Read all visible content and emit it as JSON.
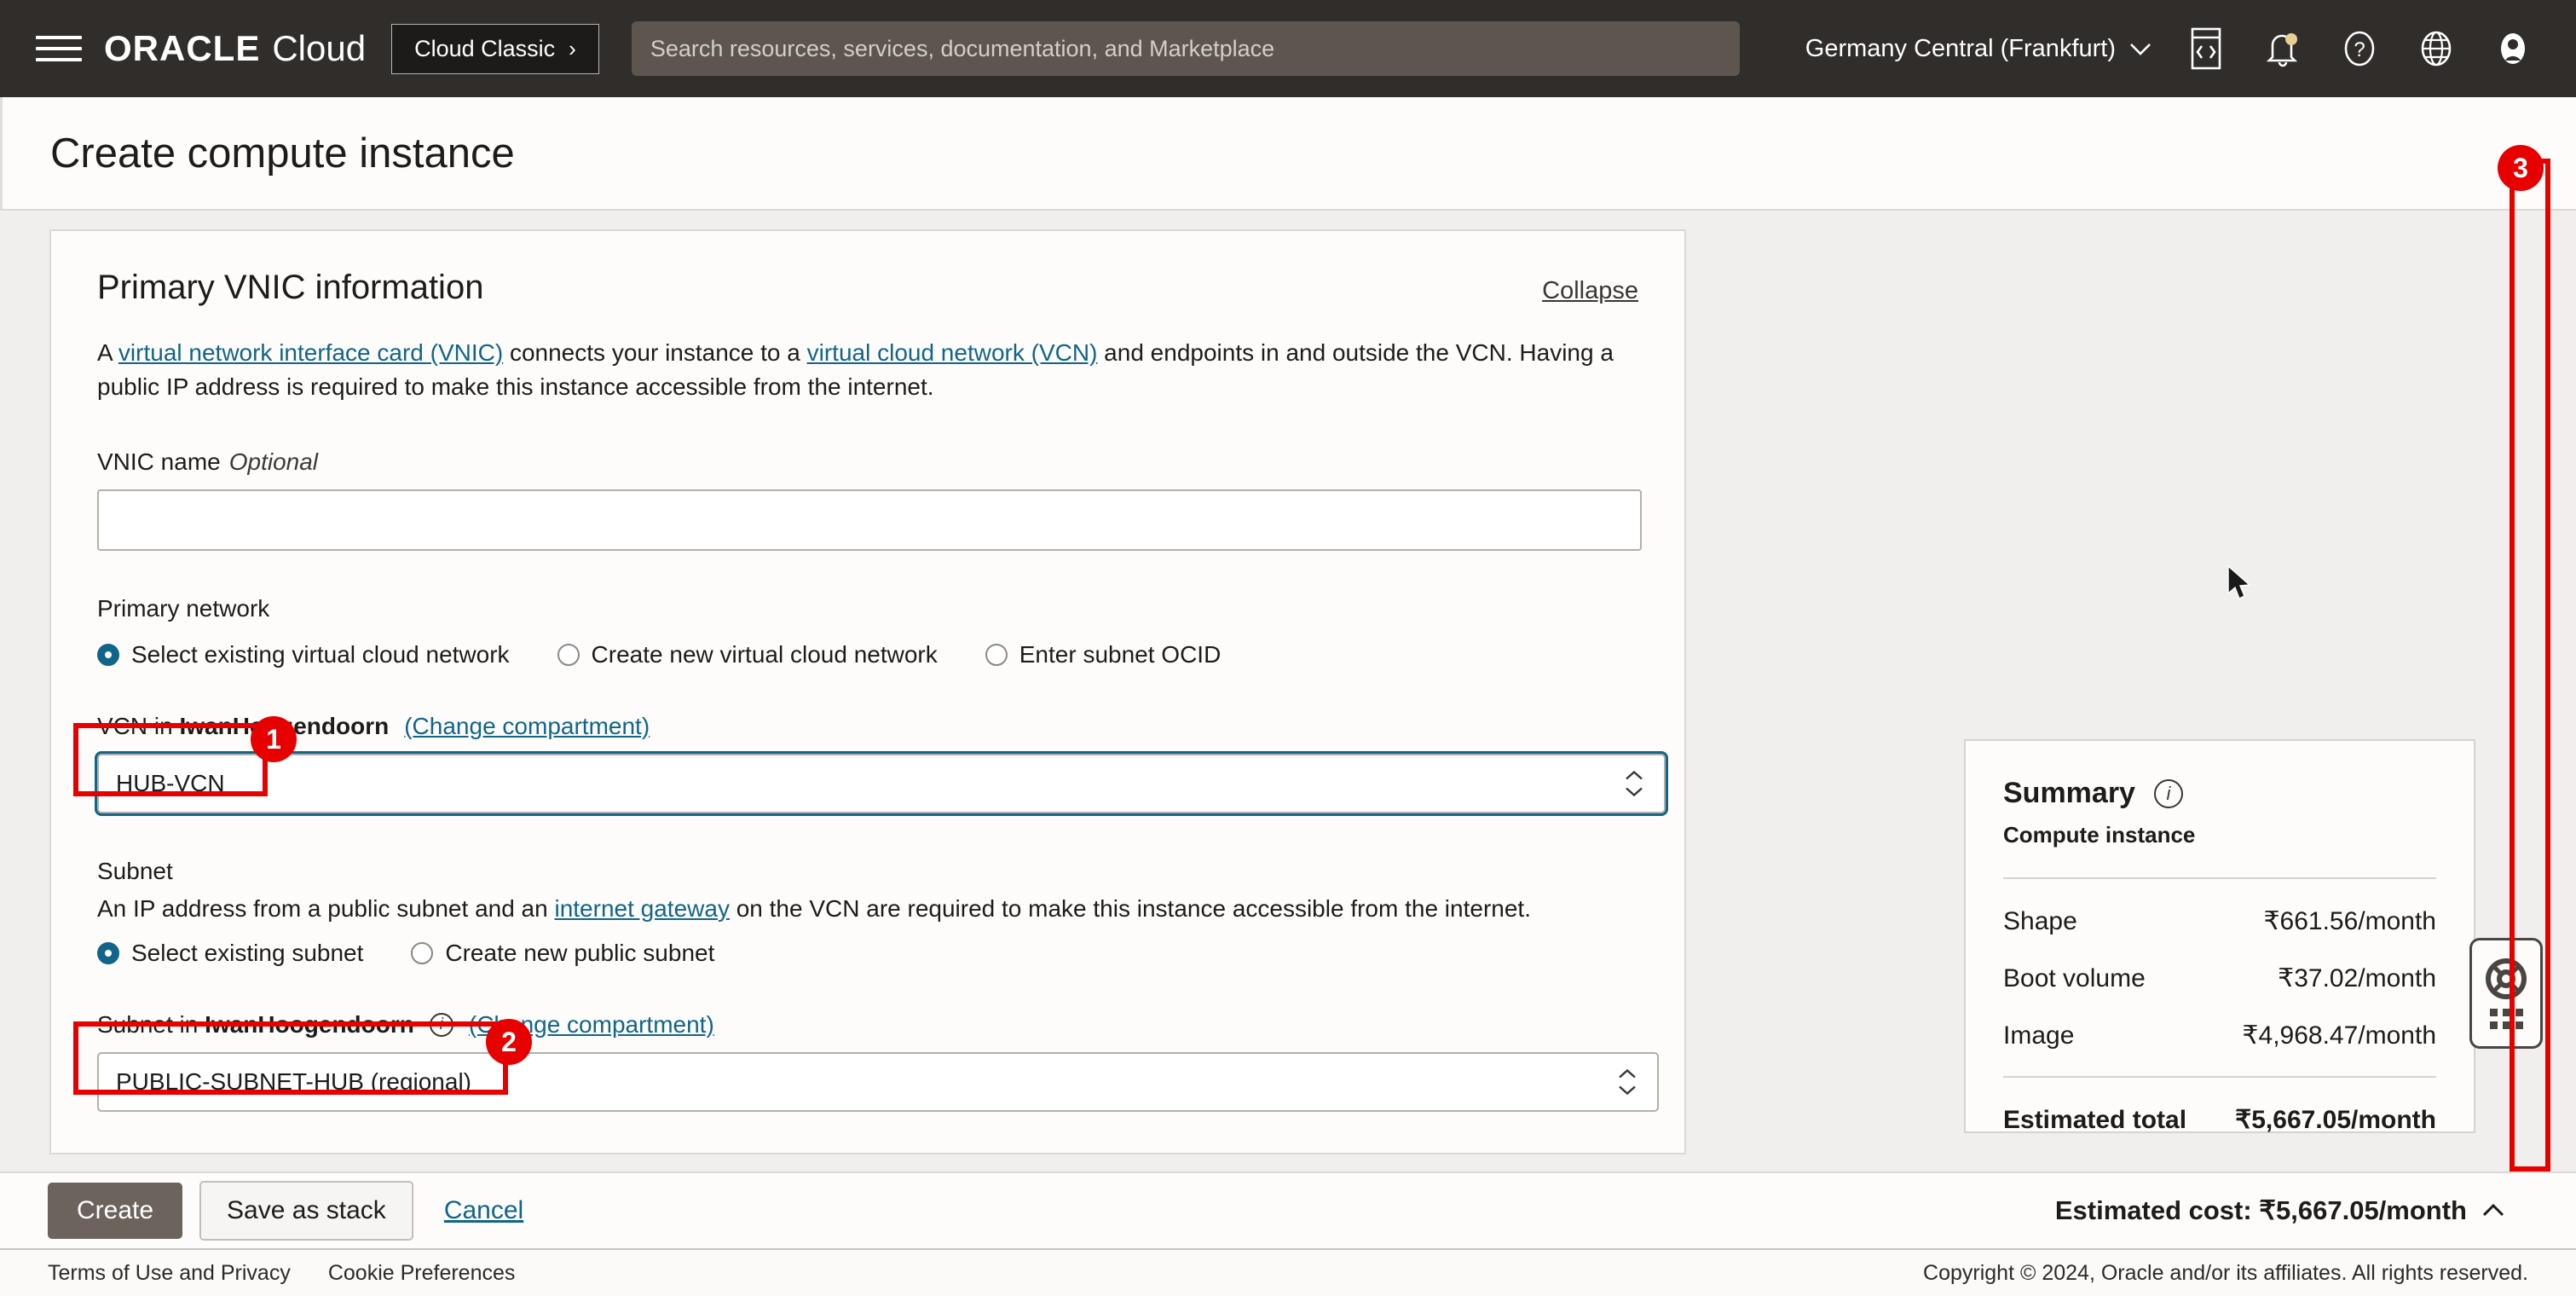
{
  "topbar": {
    "menu_icon": "hamburger-icon",
    "brand_oracle": "ORACLE",
    "brand_cloud": "Cloud",
    "cloud_classic_label": "Cloud Classic",
    "cloud_classic_chevron": "›",
    "search_placeholder": "Search resources, services, documentation, and Marketplace",
    "search_value": "",
    "region": "Germany Central (Frankfurt)",
    "region_chevron": "∨",
    "icons": [
      "cloud-shell-icon",
      "notifications-bell-icon",
      "help-question-icon",
      "language-globe-icon",
      "user-avatar-icon"
    ],
    "notification_dot_color": "#e8cf94"
  },
  "page": {
    "title": "Create compute instance"
  },
  "card": {
    "title": "Primary VNIC information",
    "collapse_label": "Collapse",
    "desc_pre": "A ",
    "desc_link1": "virtual network interface card (VNIC)",
    "desc_mid": " connects your instance to a ",
    "desc_link2": "virtual cloud network (VCN)",
    "desc_post": " and endpoints in and outside the VCN. Having a public IP address is required to make this instance accessible from the internet.",
    "vnic_name_label": "VNIC name",
    "vnic_name_optional": "Optional",
    "vnic_name_value": "",
    "vnic_name_placeholder": "",
    "primary_network_label": "Primary network",
    "primary_network_options": [
      {
        "label": "Select existing virtual cloud network",
        "selected": true
      },
      {
        "label": "Create new virtual cloud network",
        "selected": false
      },
      {
        "label": "Enter subnet OCID",
        "selected": false
      }
    ],
    "vcn_label_pre": "VCN in ",
    "vcn_compartment": "IwanHoogendoorn",
    "vcn_change_link": "(Change compartment)",
    "vcn_value": "HUB-VCN",
    "subnet_heading": "Subnet",
    "subnet_desc_pre": "An IP address from a public subnet and an ",
    "subnet_desc_link": "internet gateway",
    "subnet_desc_post": " on the VCN are required to make this instance accessible from the internet.",
    "subnet_options": [
      {
        "label": "Select existing subnet",
        "selected": true
      },
      {
        "label": "Create new public subnet",
        "selected": false
      }
    ],
    "subnet_label_pre": "Subnet in ",
    "subnet_compartment": "IwanHoogendoorn",
    "subnet_info_icon": "info-icon",
    "subnet_change_link": "(Change compartment)",
    "subnet_value": "PUBLIC-SUBNET-HUB (regional)"
  },
  "annotations": {
    "badge1": "1",
    "badge2": "2",
    "badge3": "3",
    "color": "#e60000"
  },
  "summary": {
    "title": "Summary",
    "info_icon": "info-icon",
    "subtitle": "Compute instance",
    "rows": [
      {
        "label": "Shape",
        "value": "₹661.56/month"
      },
      {
        "label": "Boot volume",
        "value": "₹37.02/month"
      },
      {
        "label": "Image",
        "value": "₹4,968.47/month"
      }
    ],
    "total_label": "Estimated total",
    "total_value": "₹5,667.05/month"
  },
  "help_fab": {
    "lifebuoy_icon": "lifebuoy-icon",
    "grid_icon": "app-grid-icon"
  },
  "actions": {
    "create_label": "Create",
    "save_stack_label": "Save as stack",
    "cancel_label": "Cancel",
    "estimated_cost": "Estimated cost: ₹5,667.05/month",
    "estimated_cost_chevron": "∧"
  },
  "footer": {
    "terms": "Terms of Use and Privacy",
    "cookies": "Cookie Preferences",
    "copyright": "Copyright © 2024, Oracle and/or its affiliates. All rights reserved."
  }
}
